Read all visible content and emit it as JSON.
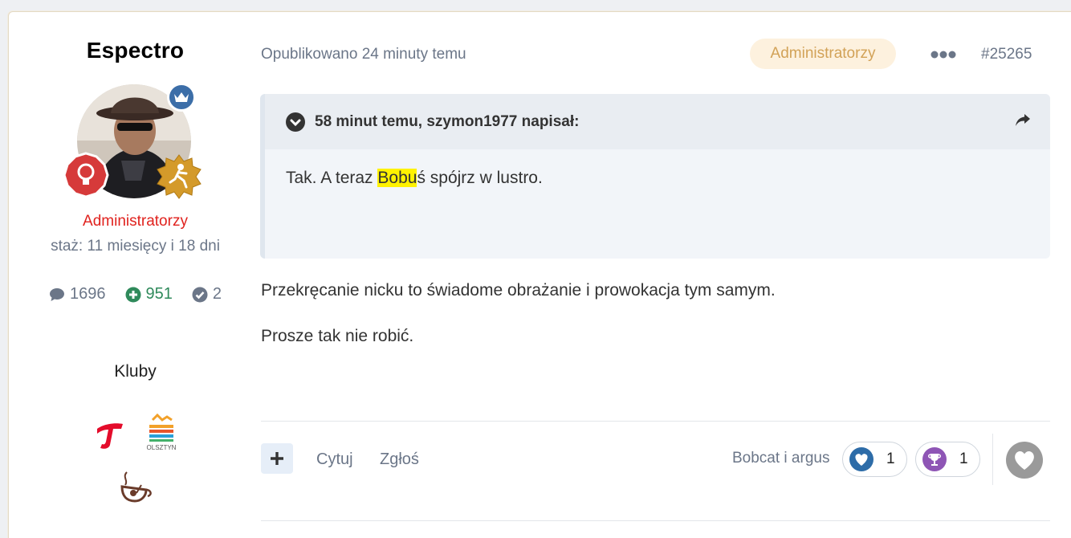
{
  "author": {
    "name": "Espectro",
    "group": "Administratorzy",
    "tenure": "staż: 11 miesięcy i 18 dni",
    "stats": {
      "posts": "1696",
      "reputation": "951",
      "achievements": "2"
    },
    "clubs_title": "Kluby",
    "clubs": [
      "club-t-logo",
      "club-olsztyn-logo",
      "club-coffee-logo"
    ],
    "rank_icon": "crown-icon",
    "award_icons": [
      "lightbulb-award-icon",
      "gold-runner-award-icon"
    ],
    "club_logo_text": "OLSZTYN"
  },
  "post": {
    "published": "Opublikowano 24 minuty temu",
    "group_badge": "Administratorzy",
    "number": "#25265",
    "quote": {
      "header": "58 minut temu, szymon1977 napisał:",
      "text_before": "Tak. A teraz ",
      "text_highlight": "Bobu",
      "text_after": "ś spójrz w lustro."
    },
    "paragraphs": [
      "Przekręcanie nicku to świadome obrażanie i prowokacja tym samym.",
      "Prosze tak nie robić."
    ],
    "actions": {
      "quote": "Cytuj",
      "report": "Zgłoś"
    },
    "reactions": {
      "reacted_by": "Bobcat i argus",
      "items": [
        {
          "icon": "heart-icon",
          "count": "1",
          "color": "#2d6ca8"
        },
        {
          "icon": "trophy-icon",
          "count": "1",
          "color": "#8e55b5"
        }
      ]
    }
  },
  "colors": {
    "admin_red": "#e0221e",
    "badge_bg": "#fdf1de",
    "badge_text": "#d2a257",
    "reputation_green": "#2f8a5b"
  }
}
